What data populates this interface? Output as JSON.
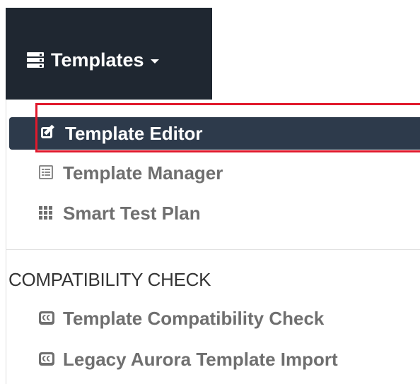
{
  "navbar": {
    "toggle_label": "Templates",
    "toggle_icon": "server-icon",
    "background": "#1f2731"
  },
  "menu": {
    "items": [
      {
        "label": "Template Editor",
        "icon": "edit-icon",
        "active": true
      },
      {
        "label": "Template Manager",
        "icon": "list-icon",
        "active": false
      },
      {
        "label": "Smart Test Plan",
        "icon": "grid-icon",
        "active": false
      }
    ],
    "section_header": "COMPATIBILITY CHECK",
    "section_items": [
      {
        "label": "Template Compatibility Check",
        "icon": "cc-icon"
      },
      {
        "label": "Legacy Aurora Template Import",
        "icon": "cc-icon"
      }
    ]
  },
  "colors": {
    "active_bg": "#2d3a4b",
    "highlight": "#e0192c",
    "item_text": "#6f6f6f"
  }
}
